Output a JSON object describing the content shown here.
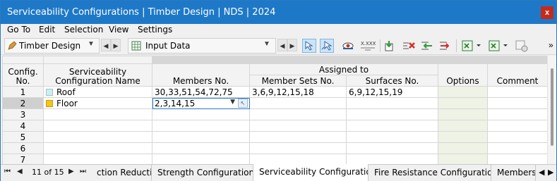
{
  "window": {
    "title": "Serviceability Configurations | Timber Design | NDS | 2024",
    "close_label": "x"
  },
  "menu": {
    "items": [
      "Go To",
      "Edit",
      "Selection",
      "View",
      "Settings"
    ]
  },
  "toolbar": {
    "module_combo": "Timber Design",
    "data_combo": "Input Data",
    "number_format_label": "X.XXX",
    "more_label": "»"
  },
  "table": {
    "headers": {
      "config_no": "Config. No.",
      "name": "Serviceability Configuration Name",
      "members": "Members No.",
      "assigned_to": "Assigned to",
      "member_sets": "Member Sets No.",
      "surfaces": "Surfaces No.",
      "options": "Options",
      "comment": "Comment"
    },
    "rows": [
      {
        "no": "1",
        "name": "Roof",
        "color": "#c6f1f5",
        "members": "30,33,51,54,72,75",
        "member_sets": "3,6,9,12,15,18",
        "surfaces": "6,9,12,15,19",
        "options": "",
        "comment": ""
      },
      {
        "no": "2",
        "name": "Floor",
        "color": "#f5c518",
        "members": "2,3,14,15",
        "member_sets": "",
        "surfaces": "",
        "options": "",
        "comment": ""
      },
      {
        "no": "3",
        "name": "",
        "color": "",
        "members": "",
        "member_sets": "",
        "surfaces": "",
        "options": "",
        "comment": ""
      },
      {
        "no": "4",
        "name": "",
        "color": "",
        "members": "",
        "member_sets": "",
        "surfaces": "",
        "options": "",
        "comment": ""
      },
      {
        "no": "5",
        "name": "",
        "color": "",
        "members": "",
        "member_sets": "",
        "surfaces": "",
        "options": "",
        "comment": ""
      },
      {
        "no": "6",
        "name": "",
        "color": "",
        "members": "",
        "member_sets": "",
        "surfaces": "",
        "options": "",
        "comment": ""
      },
      {
        "no": "7",
        "name": "",
        "color": "",
        "members": "",
        "member_sets": "",
        "surfaces": "",
        "options": "",
        "comment": ""
      }
    ]
  },
  "pager": {
    "count": "11 of 15"
  },
  "tabs": [
    {
      "label": "ction Reductions",
      "active": false
    },
    {
      "label": "Strength Configurations",
      "active": false
    },
    {
      "label": "Serviceability Configurations",
      "active": true
    },
    {
      "label": "Fire Resistance Configurations",
      "active": false
    },
    {
      "label": "Members",
      "active": false
    }
  ],
  "colors": {
    "titlebar": "#1e78c8",
    "close": "#c42b1c",
    "selected_row": "#cfcfcf",
    "options_column": "#eef3e6"
  }
}
